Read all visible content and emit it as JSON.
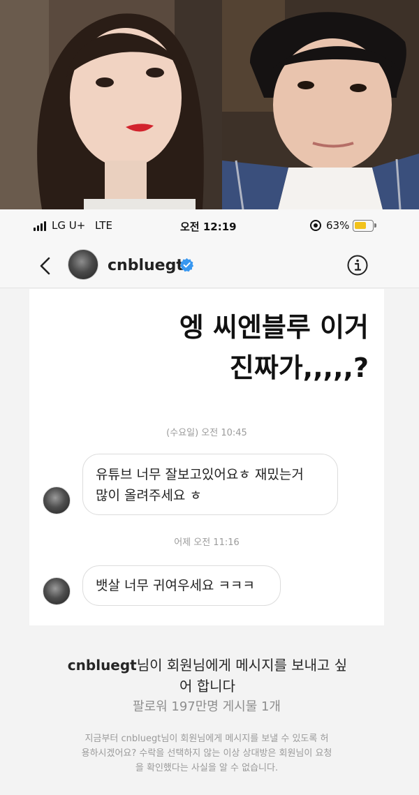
{
  "status_bar": {
    "carrier": "LG U+",
    "network": "LTE",
    "time": "오전 12:19",
    "battery": "63%",
    "battery_level": 0.63,
    "battery_color": "#f2c21b"
  },
  "header": {
    "username": "cnbluegt",
    "verified": true,
    "icons": [
      "chevron-left-icon",
      "avatar",
      "verified-badge-icon",
      "info-icon"
    ]
  },
  "overlay_text": {
    "line1": "엥 씨엔블루 이거",
    "line2": "진짜가,,,,,?"
  },
  "messages": [
    {
      "timestamp": "(수요일) 오전 10:45",
      "line1": "유튜브 너무 잘보고있어요ㅎ 재밌는거",
      "line2": "많이 올려주세요 ㅎ"
    },
    {
      "timestamp": "어제 오전 11:16",
      "line1": "뱃살 너무 귀여우세요 ㅋㅋㅋ"
    }
  ],
  "request": {
    "title_user": "cnbluegt",
    "title_line1_rest": "님이 회원님에게 메시지를 보내고 싶",
    "title_line2": "어 합니다",
    "stats": "팔로워 197만명 게시물 1개",
    "note_line1": "지금부터 cnbluegt님이 회원님에게 메시지를 보낼 수 있도록 허",
    "note_line2": "용하시겠어요? 수락을 선택하지 않는 이상 상대방은 회원님이 요청",
    "note_line3": "을 확인했다는 사실을 알 수 없습니다."
  },
  "colors": {
    "verified_blue": "#3897f0",
    "text_primary": "#262626",
    "text_secondary": "#8e8e8e"
  }
}
